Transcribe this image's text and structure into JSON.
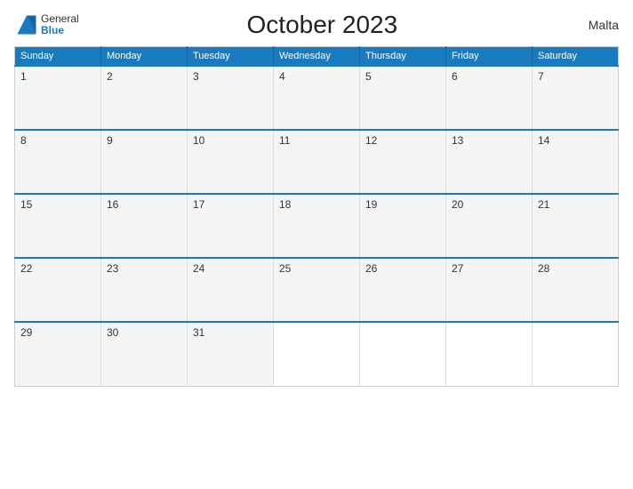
{
  "header": {
    "logo_general": "General",
    "logo_blue": "Blue",
    "title": "October 2023",
    "country": "Malta"
  },
  "weekdays": [
    "Sunday",
    "Monday",
    "Tuesday",
    "Wednesday",
    "Thursday",
    "Friday",
    "Saturday"
  ],
  "weeks": [
    [
      {
        "day": "1"
      },
      {
        "day": "2"
      },
      {
        "day": "3"
      },
      {
        "day": "4"
      },
      {
        "day": "5"
      },
      {
        "day": "6"
      },
      {
        "day": "7"
      }
    ],
    [
      {
        "day": "8"
      },
      {
        "day": "9"
      },
      {
        "day": "10"
      },
      {
        "day": "11"
      },
      {
        "day": "12"
      },
      {
        "day": "13"
      },
      {
        "day": "14"
      }
    ],
    [
      {
        "day": "15"
      },
      {
        "day": "16"
      },
      {
        "day": "17"
      },
      {
        "day": "18"
      },
      {
        "day": "19"
      },
      {
        "day": "20"
      },
      {
        "day": "21"
      }
    ],
    [
      {
        "day": "22"
      },
      {
        "day": "23"
      },
      {
        "day": "24"
      },
      {
        "day": "25"
      },
      {
        "day": "26"
      },
      {
        "day": "27"
      },
      {
        "day": "28"
      }
    ],
    [
      {
        "day": "29"
      },
      {
        "day": "30"
      },
      {
        "day": "31"
      },
      {
        "day": ""
      },
      {
        "day": ""
      },
      {
        "day": ""
      },
      {
        "day": ""
      }
    ]
  ],
  "colors": {
    "header_bg": "#1a7abf",
    "row_bg": "#f5f5f5",
    "empty_bg": "#ffffff"
  }
}
